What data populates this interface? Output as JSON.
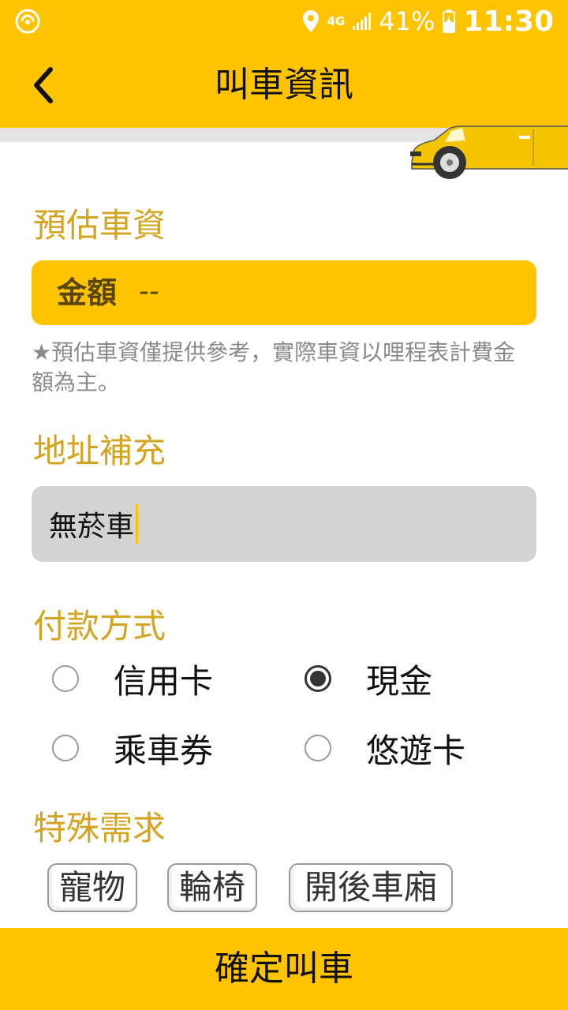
{
  "status_bar": {
    "network": "4G",
    "battery_percent": "41%",
    "time": "11:30",
    "icons": [
      "hotspot-icon",
      "location-icon",
      "signal-icon",
      "battery-icon"
    ]
  },
  "toolbar": {
    "title": "叫車資訊",
    "back_icon": "chevron-left-icon"
  },
  "fare": {
    "section_title": "預估車資",
    "amount_label": "金額",
    "amount_value": "--",
    "note": "★預估車資僅提供參考，實際車資以哩程表計費金額為主。"
  },
  "address": {
    "section_title": "地址補充",
    "value": "無菸車"
  },
  "payment": {
    "section_title": "付款方式",
    "options": [
      {
        "label": "信用卡",
        "checked": false
      },
      {
        "label": "現金",
        "checked": true
      },
      {
        "label": "乘車券",
        "checked": false
      },
      {
        "label": "悠遊卡",
        "checked": false
      }
    ]
  },
  "special": {
    "section_title": "特殊需求",
    "options": [
      "寵物",
      "輪椅",
      "開後車廂"
    ]
  },
  "confirm_button": "確定叫車",
  "colors": {
    "accent": "#FFC400",
    "section_title": "#D4A420",
    "input_bg": "#D3D3D3"
  }
}
